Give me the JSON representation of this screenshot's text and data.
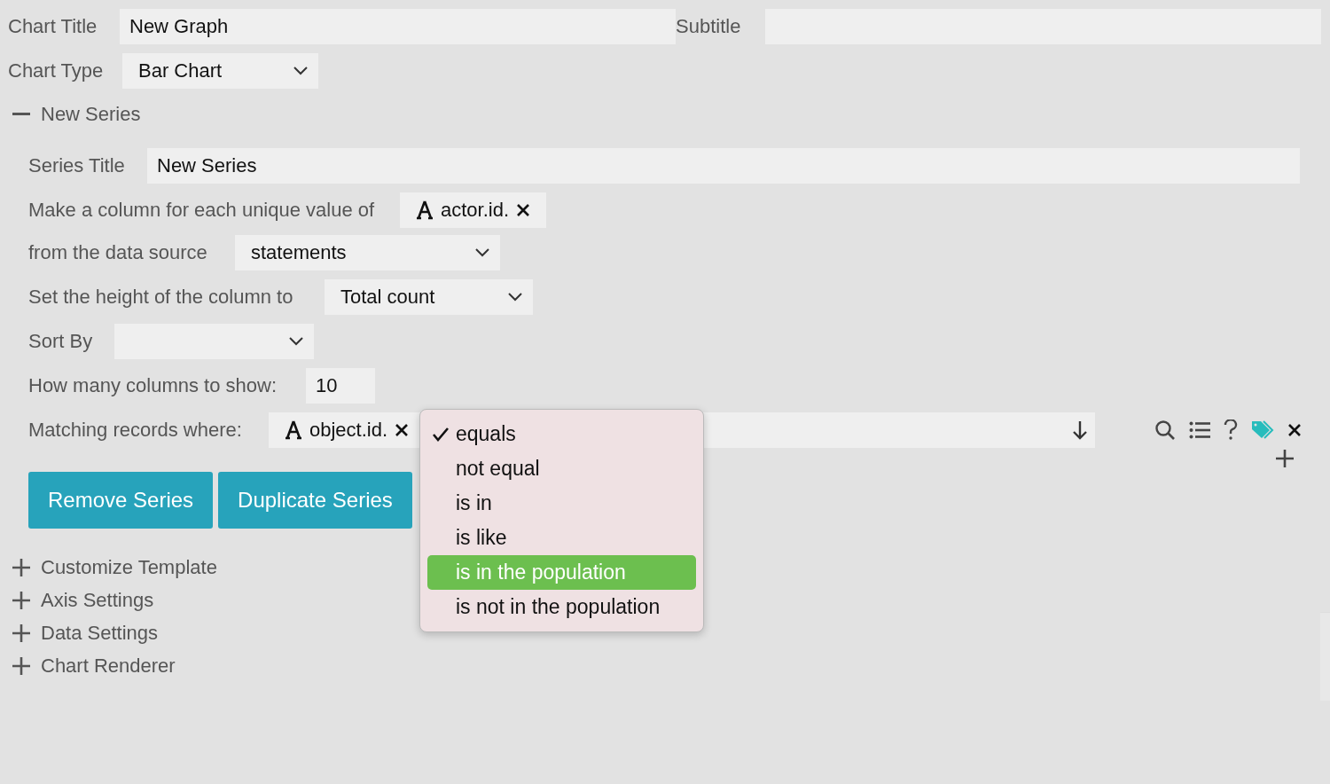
{
  "chart_title": {
    "label": "Chart Title",
    "value": "New Graph"
  },
  "subtitle": {
    "label": "Subtitle"
  },
  "chart_type": {
    "label": "Chart Type",
    "value": "Bar Chart"
  },
  "series_section": {
    "label": "New Series",
    "expanded": true
  },
  "series": {
    "title": {
      "label": "Series Title",
      "value": "New Series"
    },
    "unique_value": {
      "label": "Make a column for each unique value of",
      "chip": "actor.id."
    },
    "data_source": {
      "label": "from the data source",
      "value": "statements"
    },
    "height": {
      "label": "Set the height of the column to",
      "value": "Total count"
    },
    "sort_by": {
      "label": "Sort By"
    },
    "columns_to_show": {
      "label": "How many columns to show:",
      "value": "10"
    },
    "matching": {
      "label": "Matching records where:",
      "chip": "object.id."
    },
    "operator_menu": [
      {
        "label": "equals",
        "checked": true,
        "selected": false
      },
      {
        "label": "not equal",
        "checked": false,
        "selected": false
      },
      {
        "label": "is in",
        "checked": false,
        "selected": false
      },
      {
        "label": "is like",
        "checked": false,
        "selected": false
      },
      {
        "label": "is in the population",
        "checked": false,
        "selected": true
      },
      {
        "label": "is not in the population",
        "checked": false,
        "selected": false
      }
    ],
    "buttons": [
      "Remove Series",
      "Duplicate Series"
    ]
  },
  "sections": [
    {
      "label": "Customize Template",
      "expanded": false
    },
    {
      "label": "Axis Settings",
      "expanded": false
    },
    {
      "label": "Data Settings",
      "expanded": false
    },
    {
      "label": "Chart Renderer",
      "expanded": false
    }
  ]
}
